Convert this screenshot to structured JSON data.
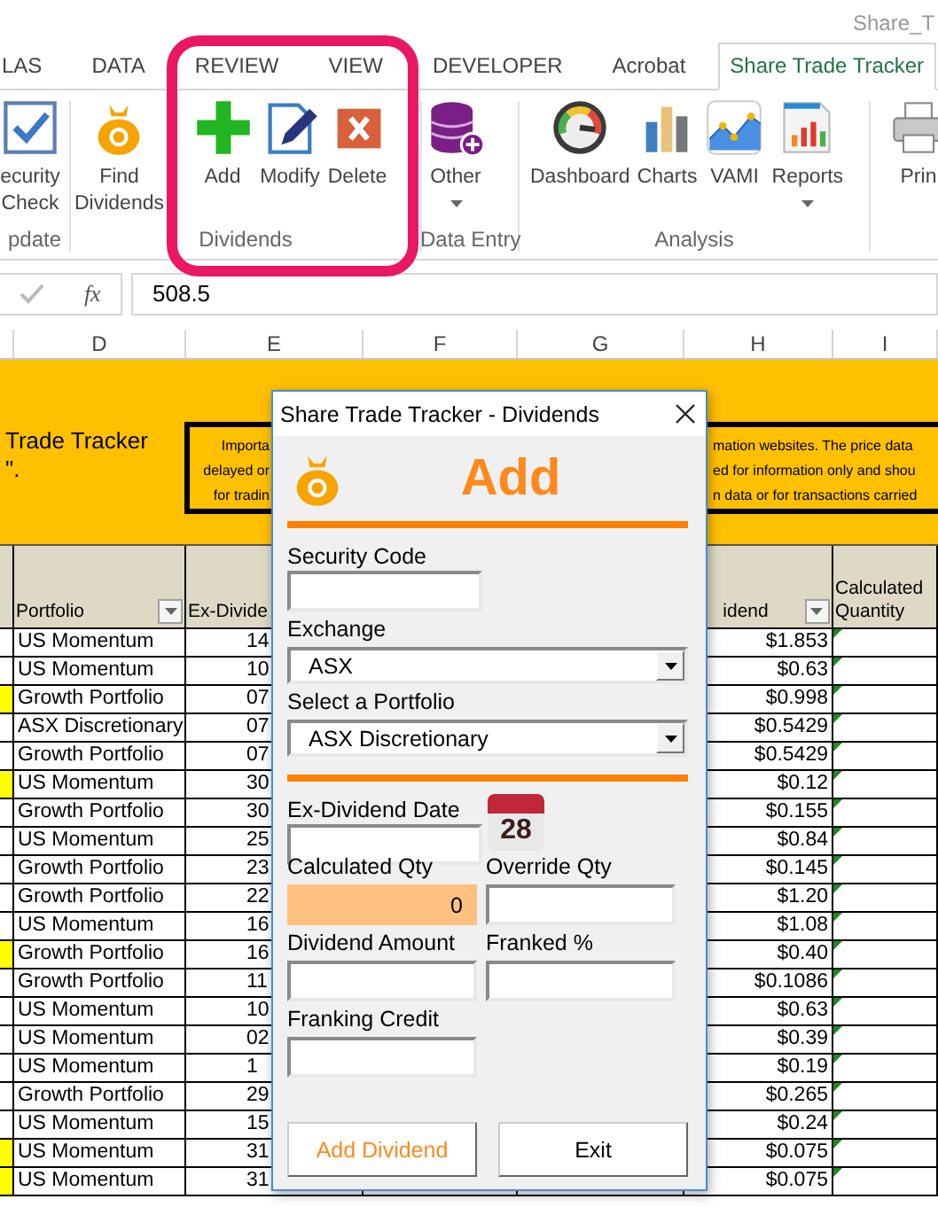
{
  "window": {
    "title": "Share_T"
  },
  "ribbon_tabs": [
    {
      "label": "LAS",
      "selected": false
    },
    {
      "label": "DATA",
      "selected": false
    },
    {
      "label": "REVIEW",
      "selected": false
    },
    {
      "label": "VIEW",
      "selected": false
    },
    {
      "label": "DEVELOPER",
      "selected": false
    },
    {
      "label": "Acrobat",
      "selected": false
    },
    {
      "label": "Share Trade Tracker",
      "selected": true
    }
  ],
  "ribbon_groups": [
    {
      "label": "pdate",
      "buttons": [
        {
          "label": "ecurity\nCheck",
          "dropdown": false
        }
      ]
    },
    {
      "label": "Dividends",
      "buttons": [
        {
          "label": "Find\nDividends",
          "dropdown": false
        },
        {
          "label": "Add",
          "dropdown": false
        },
        {
          "label": "Modify",
          "dropdown": false
        },
        {
          "label": "Delete",
          "dropdown": false
        }
      ]
    },
    {
      "label": "Data Entry",
      "buttons": [
        {
          "label": "Other",
          "dropdown": true
        }
      ]
    },
    {
      "label": "Analysis",
      "buttons": [
        {
          "label": "Dashboard",
          "dropdown": false
        },
        {
          "label": "Charts",
          "dropdown": false
        },
        {
          "label": "VAMI",
          "dropdown": false
        },
        {
          "label": "Reports",
          "dropdown": true
        }
      ]
    },
    {
      "buttons": [
        {
          "label": "Prin",
          "dropdown": false
        }
      ]
    }
  ],
  "formula_bar": {
    "function_label": "fx",
    "value": "508.5"
  },
  "sheet": {
    "column_letters": [
      "D",
      "E",
      "F",
      "G",
      "H",
      "I"
    ],
    "banner": {
      "title_lines": [
        "Trade Tracker",
        "\"."
      ],
      "notice_left": [
        "Importa",
        "delayed or",
        "for tradin"
      ],
      "notice_right": [
        "mation websites. The price data",
        "ed for information only and shou",
        "n data or for transactions carried"
      ]
    },
    "columns": [
      {
        "label": "Portfolio",
        "filter": true
      },
      {
        "label": "Ex-Divide",
        "filter": false
      },
      {
        "label": "idend",
        "filter": true
      },
      {
        "label": "Calculated Quantity",
        "filter": false
      }
    ],
    "rows": [
      {
        "highlighted": false,
        "portfolio": "US Momentum",
        "ex_dividend": "14",
        "dividend": "$1.853"
      },
      {
        "highlighted": false,
        "portfolio": "US Momentum",
        "ex_dividend": "10",
        "dividend": "$0.63"
      },
      {
        "highlighted": true,
        "portfolio": "Growth Portfolio",
        "ex_dividend": "07",
        "dividend": "$0.998"
      },
      {
        "highlighted": false,
        "portfolio": "ASX Discretionary",
        "ex_dividend": "07",
        "dividend": "$0.5429"
      },
      {
        "highlighted": false,
        "portfolio": "Growth Portfolio",
        "ex_dividend": "07",
        "dividend": "$0.5429"
      },
      {
        "highlighted": true,
        "portfolio": "US Momentum",
        "ex_dividend": "30",
        "dividend": "$0.12"
      },
      {
        "highlighted": false,
        "portfolio": "Growth Portfolio",
        "ex_dividend": "30",
        "dividend": "$0.155"
      },
      {
        "highlighted": false,
        "portfolio": "US Momentum",
        "ex_dividend": "25",
        "dividend": "$0.84"
      },
      {
        "highlighted": false,
        "portfolio": "Growth Portfolio",
        "ex_dividend": "23",
        "dividend": "$0.145"
      },
      {
        "highlighted": false,
        "portfolio": "Growth Portfolio",
        "ex_dividend": "22",
        "dividend": "$1.20"
      },
      {
        "highlighted": false,
        "portfolio": "US Momentum",
        "ex_dividend": "16",
        "dividend": "$1.08"
      },
      {
        "highlighted": true,
        "portfolio": "Growth Portfolio",
        "ex_dividend": "16",
        "dividend": "$0.40"
      },
      {
        "highlighted": false,
        "portfolio": "Growth Portfolio",
        "ex_dividend": "11",
        "dividend": "$0.1086"
      },
      {
        "highlighted": false,
        "portfolio": "US Momentum",
        "ex_dividend": "10",
        "dividend": "$0.63"
      },
      {
        "highlighted": false,
        "portfolio": "US Momentum",
        "ex_dividend": "02",
        "dividend": "$0.39"
      },
      {
        "highlighted": false,
        "portfolio": "US Momentum",
        "ex_dividend": "1",
        "dividend": "$0.19"
      },
      {
        "highlighted": false,
        "portfolio": "Growth Portfolio",
        "ex_dividend": "29",
        "dividend": "$0.265"
      },
      {
        "highlighted": false,
        "portfolio": "US Momentum",
        "ex_dividend": "15",
        "dividend": "$0.24"
      },
      {
        "highlighted": true,
        "portfolio": "US Momentum",
        "ex_dividend": "31",
        "dividend": "$0.075"
      },
      {
        "highlighted": true,
        "portfolio": "US Momentum",
        "ex_dividend": "31",
        "dividend": "$0.075"
      }
    ]
  },
  "dialog": {
    "title": "Share Trade Tracker - Dividends",
    "heading": "Add",
    "security_code": {
      "label": "Security Code"
    },
    "exchange": {
      "label": "Exchange",
      "value": "ASX"
    },
    "portfolio": {
      "label": "Select a Portfolio",
      "value": "ASX Discretionary"
    },
    "ex_dividend_date": {
      "label": "Ex-Dividend Date",
      "calendar_day": "28"
    },
    "quantity_fields": [
      {
        "label": "Calculated Qty",
        "value": "0",
        "readonly": true
      },
      {
        "label": "Override Qty",
        "readonly": false
      },
      {
        "label": "Dividend Amount",
        "readonly": false
      },
      {
        "label": "Franked %",
        "readonly": false
      },
      {
        "label": "Franking Credit",
        "readonly": false
      }
    ],
    "buttons": [
      {
        "label": "Add Dividend",
        "kind": "primary"
      },
      {
        "label": "Exit",
        "kind": "default"
      }
    ]
  }
}
